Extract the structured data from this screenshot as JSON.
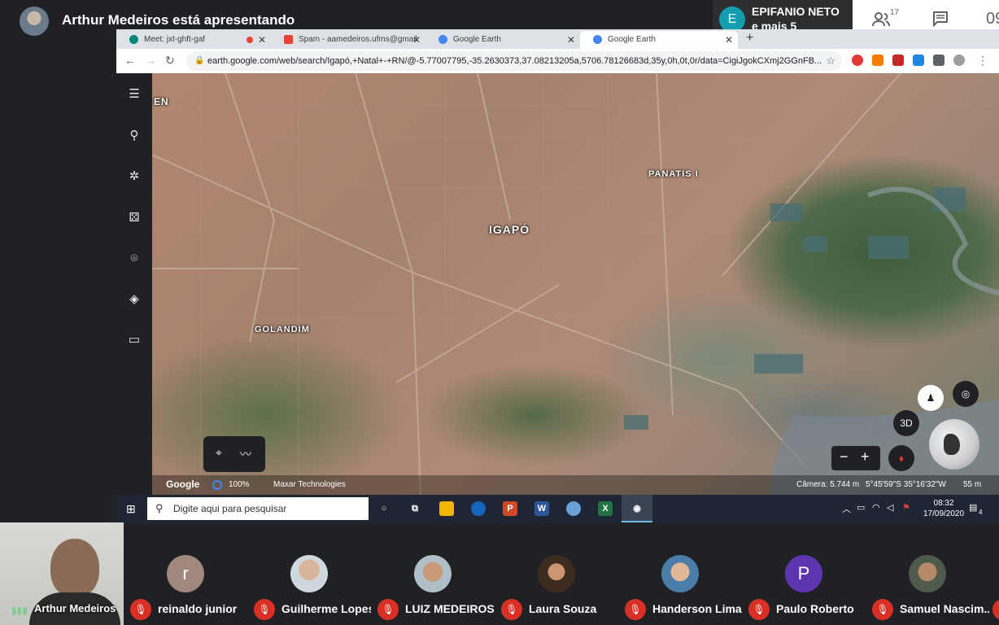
{
  "meet": {
    "presenter_text": "Arthur Medeiros está apresentando",
    "notification": {
      "initial": "E",
      "name": "EPIFANIO NETO",
      "more": "e mais 5"
    },
    "participant_count": "17",
    "clock": "09"
  },
  "browser": {
    "tabs": [
      {
        "label": "Meet: jxt-ghft-gaf"
      },
      {
        "label": "Spam - aamedeiros.ufms@gmail"
      },
      {
        "label": "Google Earth"
      },
      {
        "label": "Google Earth"
      }
    ],
    "url": "earth.google.com/web/search/Igapó,+Natal+-+RN/@-5.77007795,-35.2630373,37.08213205a,5706.78126683d,35y,0h,0t,0r/data=CigiJgokCXmj2GGnFB..."
  },
  "earth": {
    "labels": {
      "en": "EN",
      "panatis": "PANATIS I",
      "igapo": "IGAPÓ",
      "golandim": "GOLANDIM"
    },
    "btn_3d": "3D",
    "status": {
      "google": "Google",
      "loaded": "100%",
      "credit": "Maxar Technologies",
      "camera": "Câmera: 5.744 m",
      "coords": "5°45'59\"S 35°16'32\"W",
      "scale": "55 m"
    }
  },
  "taskbar": {
    "search_placeholder": "Digite aqui para pesquisar",
    "time": "08:32",
    "date": "17/09/2020",
    "notif_count": "4"
  },
  "participants": {
    "self_name": "Arthur Medeiros",
    "list": [
      {
        "name": "reinaldo junior",
        "initial": "r",
        "color": "#a1887f"
      },
      {
        "name": "Guilherme Lopes",
        "initial": "",
        "color": "#cfd8dc"
      },
      {
        "name": "LUIZ MEDEIROS",
        "initial": "",
        "color": "#b0bec5"
      },
      {
        "name": "Laura Souza",
        "initial": "",
        "color": "#8d6e63"
      },
      {
        "name": "Handerson Lima",
        "initial": "",
        "color": "#90a4ae"
      },
      {
        "name": "Paulo Roberto",
        "initial": "P",
        "color": "#5e35b1"
      },
      {
        "name": "Samuel Nascim...",
        "initial": "",
        "color": "#6d6d6d"
      }
    ]
  }
}
